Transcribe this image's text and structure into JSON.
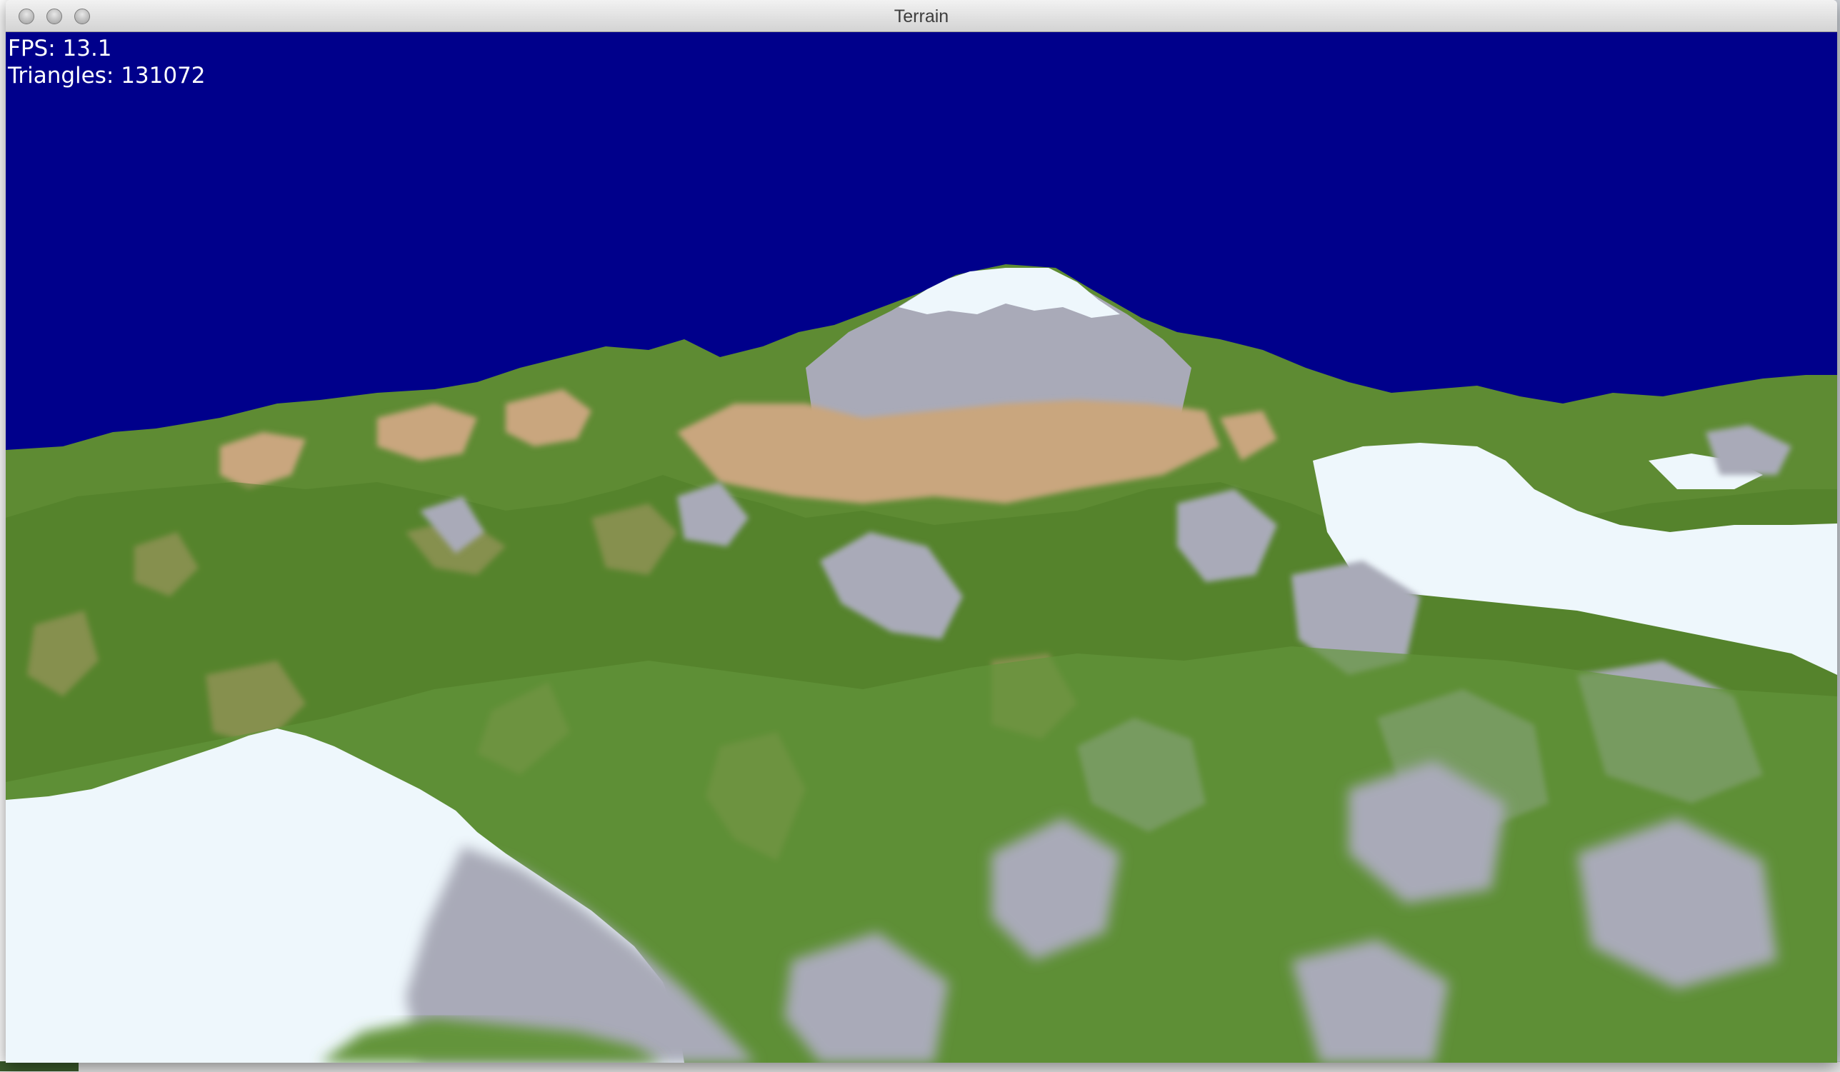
{
  "window": {
    "title": "Terrain"
  },
  "hud": {
    "fps_label": "FPS: 13.1",
    "triangles_label": "Triangles: 131072"
  },
  "colors": {
    "sky": "#00008b",
    "grass": "#5b8a2e",
    "grass_dark": "#4c7a25",
    "dirt": "#c9a67e",
    "rock": "#a9aab8",
    "snow": "#eef7fc"
  },
  "icons": {
    "close": "traffic-light-close-icon",
    "minimize": "traffic-light-minimize-icon",
    "zoom": "traffic-light-zoom-icon"
  }
}
